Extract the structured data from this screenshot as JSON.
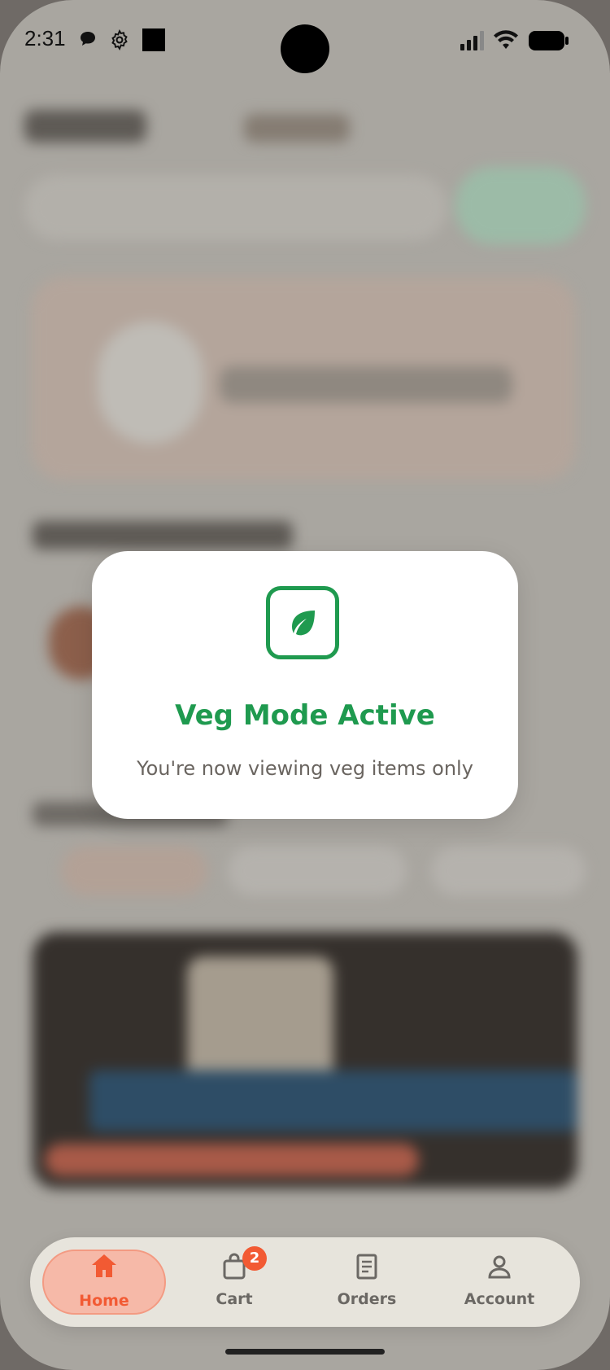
{
  "status_bar": {
    "time": "2:31",
    "icons_left": [
      "chat-icon",
      "gear-icon",
      "square-icon"
    ],
    "icons_right": [
      "signal-icon",
      "wifi-icon",
      "battery-icon"
    ]
  },
  "modal": {
    "icon": "leaf-icon",
    "title": "Veg Mode Active",
    "subtitle": "You're now viewing veg items only",
    "accent": "#1f9a4f"
  },
  "bottom_nav": {
    "items": [
      {
        "label": "Home",
        "icon": "home-icon",
        "active": true
      },
      {
        "label": "Cart",
        "icon": "shopping-bag-icon",
        "badge": "2"
      },
      {
        "label": "Orders",
        "icon": "receipt-icon"
      },
      {
        "label": "Account",
        "icon": "person-icon"
      }
    ],
    "active_color": "#f25a33"
  }
}
